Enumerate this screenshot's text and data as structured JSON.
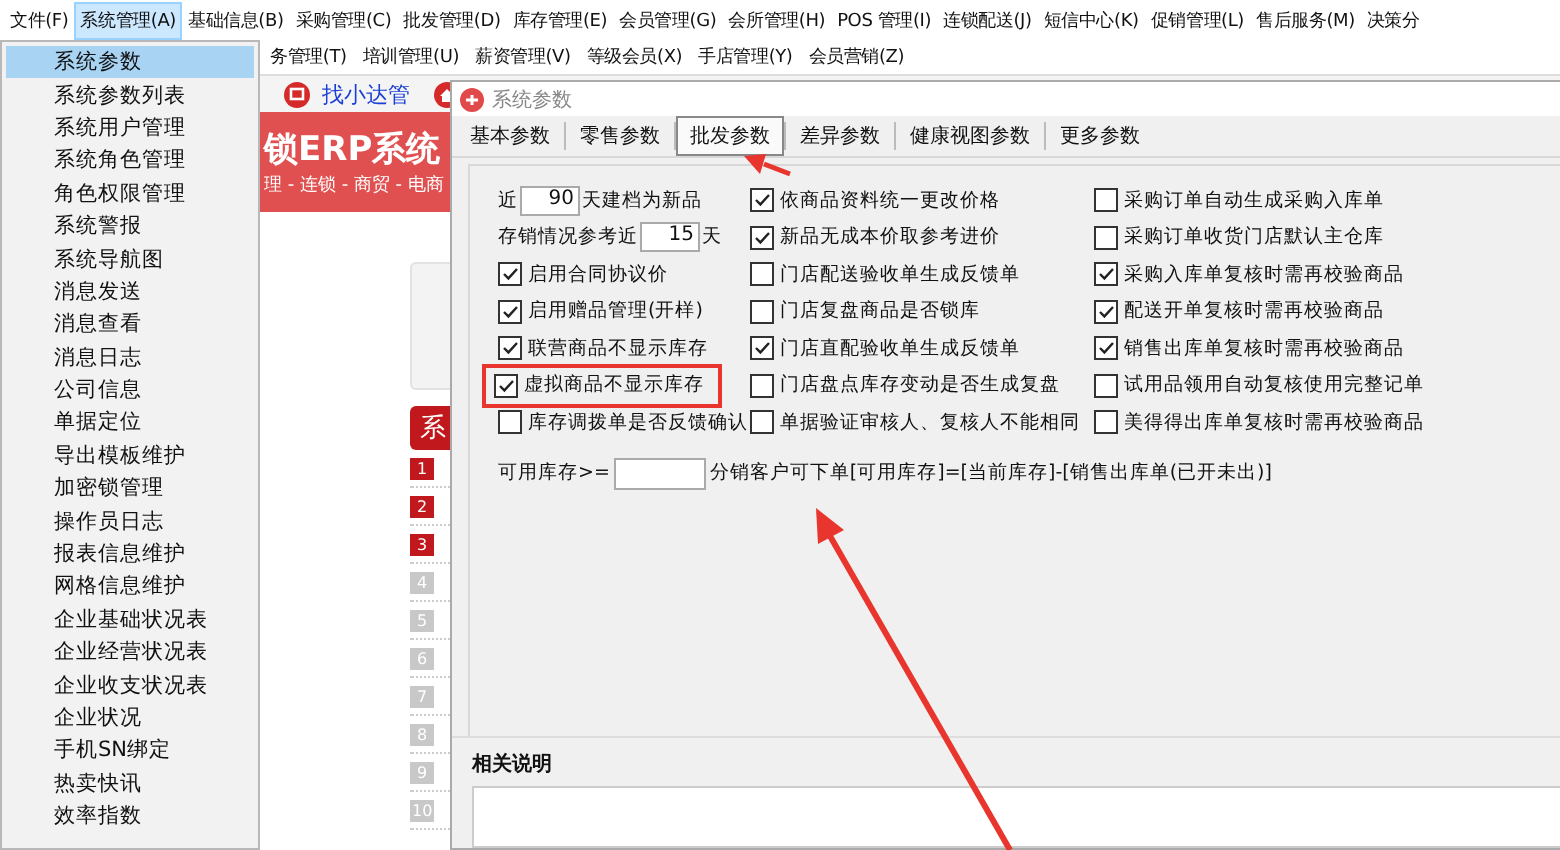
{
  "menu_bar": [
    {
      "label": "文件(F)",
      "selected": false
    },
    {
      "label": "系统管理(A)",
      "selected": true
    },
    {
      "label": "基础信息(B)",
      "selected": false
    },
    {
      "label": "采购管理(C)",
      "selected": false
    },
    {
      "label": "批发管理(D)",
      "selected": false
    },
    {
      "label": "库存管理(E)",
      "selected": false
    },
    {
      "label": "会员管理(G)",
      "selected": false
    },
    {
      "label": "会所管理(H)",
      "selected": false
    },
    {
      "label": "POS 管理(I)",
      "selected": false
    },
    {
      "label": "连锁配送(J)",
      "selected": false
    },
    {
      "label": "短信中心(K)",
      "selected": false
    },
    {
      "label": "促销管理(L)",
      "selected": false
    },
    {
      "label": "售后服务(M)",
      "selected": false
    },
    {
      "label": "决策分",
      "selected": false
    }
  ],
  "menu_bar_2": [
    {
      "label": "务管理(T)"
    },
    {
      "label": "培训管理(U)"
    },
    {
      "label": "薪资管理(V)"
    },
    {
      "label": "等级会员(X)"
    },
    {
      "label": "手店管理(Y)"
    },
    {
      "label": "会员营销(Z)"
    }
  ],
  "toolbar": {
    "label": "找小达管"
  },
  "banner": {
    "title": "锁ERP系统",
    "subtitle": "理 - 连锁 - 商贸 - 电商"
  },
  "side_button": "系",
  "badges": [
    {
      "label": "1",
      "highlighted": true
    },
    {
      "label": "2",
      "highlighted": true
    },
    {
      "label": "3",
      "highlighted": true
    },
    {
      "label": "4",
      "highlighted": false
    },
    {
      "label": "5",
      "highlighted": false
    },
    {
      "label": "6",
      "highlighted": false
    },
    {
      "label": "7",
      "highlighted": false
    },
    {
      "label": "8",
      "highlighted": false
    },
    {
      "label": "9",
      "highlighted": false
    },
    {
      "label": "10",
      "highlighted": false
    }
  ],
  "dropdown": [
    {
      "label": "系统参数",
      "selected": true
    },
    {
      "label": "系统参数列表",
      "selected": false
    },
    {
      "label": "系统用户管理",
      "selected": false
    },
    {
      "label": "系统角色管理",
      "selected": false
    },
    {
      "label": "角色权限管理",
      "selected": false
    },
    {
      "label": "系统警报",
      "selected": false
    },
    {
      "label": "系统导航图",
      "selected": false
    },
    {
      "label": "消息发送",
      "selected": false
    },
    {
      "label": "消息查看",
      "selected": false
    },
    {
      "label": "消息日志",
      "selected": false
    },
    {
      "label": "公司信息",
      "selected": false
    },
    {
      "label": "单据定位",
      "selected": false
    },
    {
      "label": "导出模板维护",
      "selected": false
    },
    {
      "label": "加密锁管理",
      "selected": false
    },
    {
      "label": "操作员日志",
      "selected": false
    },
    {
      "label": "报表信息维护",
      "selected": false
    },
    {
      "label": "网格信息维护",
      "selected": false
    },
    {
      "label": "企业基础状况表",
      "selected": false
    },
    {
      "label": "企业经营状况表",
      "selected": false
    },
    {
      "label": "企业收支状况表",
      "selected": false
    },
    {
      "label": "企业状况",
      "selected": false
    },
    {
      "label": "手机SN绑定",
      "selected": false
    },
    {
      "label": "热卖快讯",
      "selected": false
    },
    {
      "label": "效率指数",
      "selected": false
    }
  ],
  "dialog": {
    "title": "系统参数",
    "tabs": [
      {
        "label": "基本参数",
        "selected": false
      },
      {
        "label": "零售参数",
        "selected": false
      },
      {
        "label": "批发参数",
        "selected": true
      },
      {
        "label": "差异参数",
        "selected": false
      },
      {
        "label": "健康视图参数",
        "selected": false
      },
      {
        "label": "更多参数",
        "selected": false
      }
    ],
    "columns": [
      [
        {
          "kind": "number",
          "prefix": "近",
          "value": "90",
          "suffix": "天建档为新品"
        },
        {
          "kind": "number",
          "prefix": "存销情况参考近",
          "value": "15",
          "suffix": "天"
        },
        {
          "kind": "checkbox",
          "label": "启用合同协议价",
          "checked": true,
          "highlighted": false
        },
        {
          "kind": "checkbox",
          "label": "启用赠品管理(开样)",
          "checked": true,
          "highlighted": false
        },
        {
          "kind": "checkbox",
          "label": "联营商品不显示库存",
          "checked": true,
          "highlighted": false
        },
        {
          "kind": "checkbox",
          "label": "虚拟商品不显示库存",
          "checked": true,
          "highlighted": true
        },
        {
          "kind": "checkbox",
          "label": "库存调拨单是否反馈确认",
          "checked": false,
          "highlighted": false
        }
      ],
      [
        {
          "kind": "checkbox",
          "label": "依商品资料统一更改价格",
          "checked": true,
          "highlighted": false
        },
        {
          "kind": "checkbox",
          "label": "新品无成本价取参考进价",
          "checked": true,
          "highlighted": false
        },
        {
          "kind": "checkbox",
          "label": "门店配送验收单生成反馈单",
          "checked": false,
          "highlighted": false
        },
        {
          "kind": "checkbox",
          "label": "门店复盘商品是否锁库",
          "checked": false,
          "highlighted": false
        },
        {
          "kind": "checkbox",
          "label": "门店直配验收单生成反馈单",
          "checked": true,
          "highlighted": false
        },
        {
          "kind": "checkbox",
          "label": "门店盘点库存变动是否生成复盘",
          "checked": false,
          "highlighted": false
        },
        {
          "kind": "checkbox",
          "label": "单据验证审核人、复核人不能相同",
          "checked": false,
          "highlighted": false
        }
      ],
      [
        {
          "kind": "checkbox",
          "label": "采购订单自动生成采购入库单",
          "checked": false,
          "highlighted": false
        },
        {
          "kind": "checkbox",
          "label": "采购订单收货门店默认主仓库",
          "checked": false,
          "highlighted": false
        },
        {
          "kind": "checkbox",
          "label": "采购入库单复核时需再校验商品",
          "checked": true,
          "highlighted": false
        },
        {
          "kind": "checkbox",
          "label": "配送开单复核时需再校验商品",
          "checked": true,
          "highlighted": false
        },
        {
          "kind": "checkbox",
          "label": "销售出库单复核时需再校验商品",
          "checked": true,
          "highlighted": false
        },
        {
          "kind": "checkbox",
          "label": "试用品领用自动复核使用完整记单",
          "checked": false,
          "highlighted": false
        },
        {
          "kind": "checkbox",
          "label": "美得得出库单复核时需再校验商品",
          "checked": false,
          "highlighted": false
        }
      ]
    ],
    "stock": {
      "label": "可用库存>=",
      "note": "分销客户可下单[可用库存]=[当前库存]-[销售出库单(已开未出)]"
    },
    "notes_title": "相关说明"
  }
}
